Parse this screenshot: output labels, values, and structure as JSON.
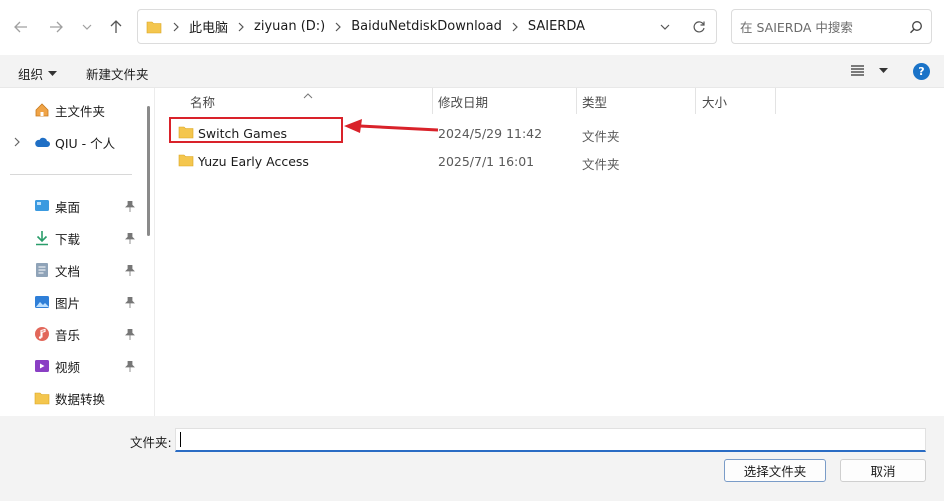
{
  "navigation": {
    "back_icon": "arrow-left-icon",
    "forward_icon": "arrow-right-icon",
    "recent_icon": "chevron-down-icon",
    "up_icon": "arrow-up-icon"
  },
  "breadcrumb": [
    "此电脑",
    "ziyuan (D:)",
    "BaiduNetdiskDownload",
    "SAIERDA"
  ],
  "search": {
    "placeholder": "在 SAIERDA 中搜索"
  },
  "toolbar": {
    "organize_label": "组织",
    "new_folder_label": "新建文件夹"
  },
  "sidebar": {
    "top_items": [
      {
        "label": "主文件夹",
        "icon": "home-icon"
      },
      {
        "label": "QIU - 个人",
        "icon": "cloud-icon"
      }
    ],
    "quick_access": [
      {
        "label": "桌面",
        "icon": "desktop-icon",
        "pinned": true
      },
      {
        "label": "下载",
        "icon": "download-icon",
        "pinned": true
      },
      {
        "label": "文档",
        "icon": "document-icon",
        "pinned": true
      },
      {
        "label": "图片",
        "icon": "picture-icon",
        "pinned": true
      },
      {
        "label": "音乐",
        "icon": "music-icon",
        "pinned": true
      },
      {
        "label": "视频",
        "icon": "video-icon",
        "pinned": true
      },
      {
        "label": "数据转换",
        "icon": "folder-icon",
        "pinned": false
      }
    ]
  },
  "columns": [
    "名称",
    "修改日期",
    "类型",
    "大小"
  ],
  "files": [
    {
      "name": "Switch Games",
      "modified": "2024/5/29 11:42",
      "type": "文件夹",
      "size": ""
    },
    {
      "name": "Yuzu Early Access",
      "modified": "2025/7/1 16:01",
      "type": "文件夹",
      "size": ""
    }
  ],
  "footer": {
    "folder_label": "文件夹:",
    "folder_value": "",
    "select_button": "选择文件夹",
    "cancel_button": "取消"
  },
  "colors": {
    "accent": "#2a6cc4",
    "annotation_red": "#d9222a",
    "folder_yellow": "#f4c64e",
    "help_blue": "#1a73c8"
  }
}
